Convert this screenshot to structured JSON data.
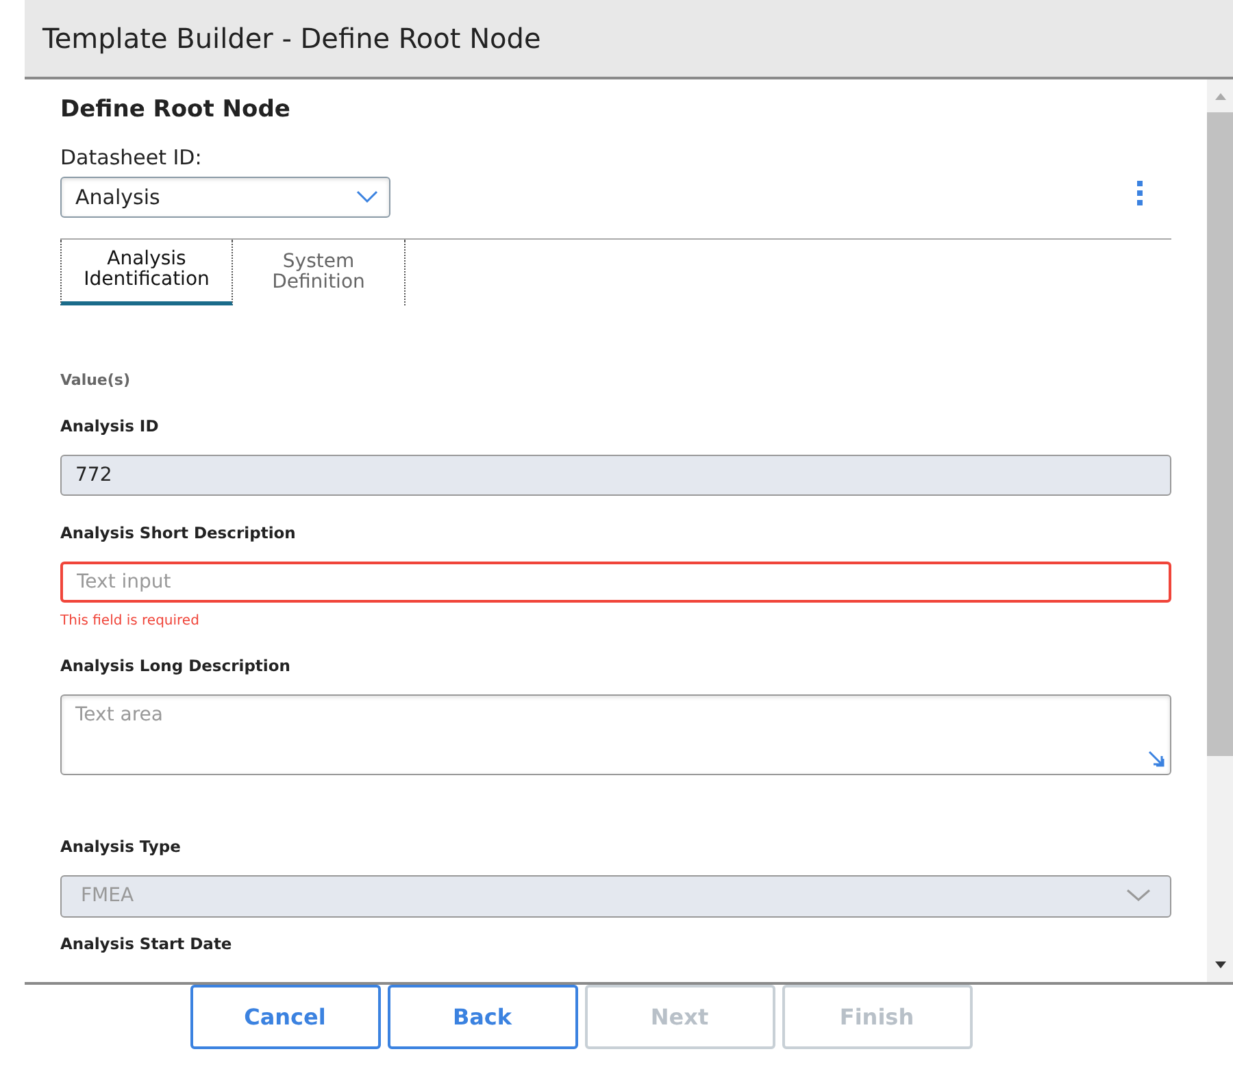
{
  "window": {
    "title": "Template Builder - Define Root Node"
  },
  "section_title": "Define Root Node",
  "datasheet": {
    "label": "Datasheet ID:",
    "value": "Analysis"
  },
  "tabs": [
    {
      "label": "Analysis Identification",
      "selected": true
    },
    {
      "label": "System Definition",
      "selected": false
    }
  ],
  "values_heading": "Value(s)",
  "fields": [
    {
      "kind": "readonly",
      "label": "Analysis ID",
      "value": "772"
    },
    {
      "kind": "text",
      "label": "Analysis Short Description",
      "placeholder": "Text input",
      "error": "This field is required"
    },
    {
      "kind": "textarea",
      "label": "Analysis Long Description",
      "placeholder": "Text area"
    },
    {
      "kind": "select",
      "label": "Analysis Type",
      "value": "FMEA",
      "disabled": true
    },
    {
      "kind": "label",
      "label": "Analysis Start Date"
    }
  ],
  "buttons": [
    {
      "label": "Cancel",
      "disabled": false
    },
    {
      "label": "Back",
      "disabled": false
    },
    {
      "label": "Next",
      "disabled": true
    },
    {
      "label": "Finish",
      "disabled": true
    }
  ]
}
